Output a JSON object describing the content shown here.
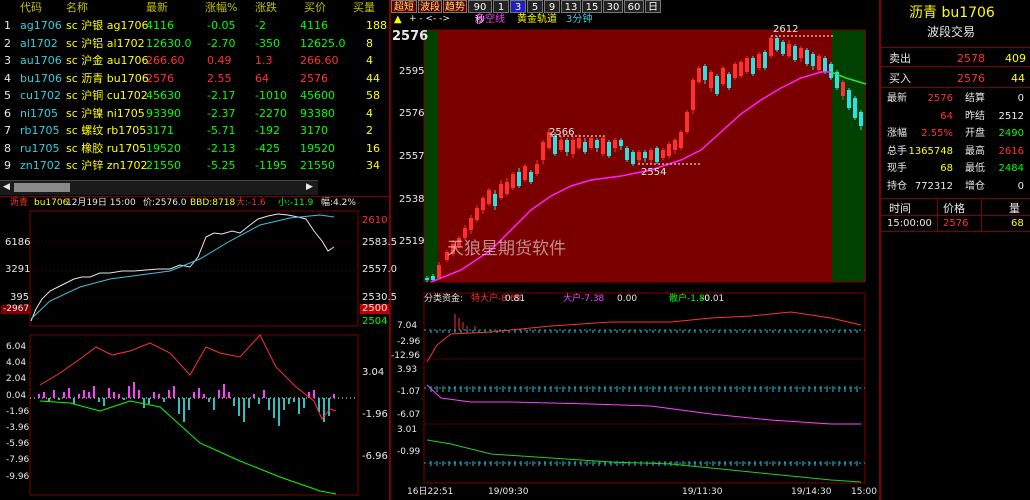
{
  "table": {
    "headers": [
      "代码",
      "名称",
      "最新",
      "涨幅%",
      "涨跌",
      "买价",
      "买量"
    ],
    "rows": [
      {
        "idx": "1",
        "code": "ag1706",
        "name": "sc 沪银 ag1706",
        "last": "4116",
        "pct": "-0.05",
        "chg": "-2",
        "bid": "4116",
        "vol": "188",
        "dir": "down"
      },
      {
        "idx": "2",
        "code": "al1702",
        "name": "sc 沪铝 al1702",
        "last": "12630.0",
        "pct": "-2.70",
        "chg": "-350",
        "bid": "12625.0",
        "vol": "8",
        "dir": "down"
      },
      {
        "idx": "3",
        "code": "au1706",
        "name": "sc 沪金 au1706",
        "last": "266.60",
        "pct": "0.49",
        "chg": "1.3",
        "bid": "266.60",
        "vol": "4",
        "dir": "up"
      },
      {
        "idx": "4",
        "code": "bu1706",
        "name": "sc 沥青 bu1706",
        "last": "2576",
        "pct": "2.55",
        "chg": "64",
        "bid": "2576",
        "vol": "44",
        "dir": "up"
      },
      {
        "idx": "5",
        "code": "cu1702",
        "name": "sc 沪铜 cu1702",
        "last": "45630",
        "pct": "-2.17",
        "chg": "-1010",
        "bid": "45600",
        "vol": "58",
        "dir": "down"
      },
      {
        "idx": "6",
        "code": "ni1705",
        "name": "sc 沪镍 ni1705",
        "last": "93390",
        "pct": "-2.37",
        "chg": "-2270",
        "bid": "93380",
        "vol": "4",
        "dir": "down"
      },
      {
        "idx": "7",
        "code": "rb1705",
        "name": "sc 螺纹 rb1705",
        "last": "3171",
        "pct": "-5.71",
        "chg": "-192",
        "bid": "3170",
        "vol": "2",
        "dir": "down"
      },
      {
        "idx": "8",
        "code": "ru1705",
        "name": "sc 橡胶 ru1705",
        "last": "19520",
        "pct": "-2.13",
        "chg": "-425",
        "bid": "19520",
        "vol": "16",
        "dir": "down"
      },
      {
        "idx": "9",
        "code": "zn1702",
        "name": "sc 沪锌 zn1702",
        "last": "21550",
        "pct": "-5.25",
        "chg": "-1195",
        "bid": "21550",
        "vol": "34",
        "dir": "down"
      }
    ]
  },
  "intraday": {
    "title_name": "沥青",
    "title_code": "bu1706",
    "date": "12月19日 15:00",
    "price_label": "价:2576.0",
    "bbd": "BBD:8718",
    "big": "大:-1.6",
    "small": "小:-11.9",
    "amp": "幅:4.2%",
    "left_scale": [
      "6186",
      "3291",
      "395",
      "-2967"
    ],
    "right_scale": [
      "2610",
      "2583.5",
      "2557.0",
      "2530.5",
      "2500",
      "2504"
    ],
    "lower_left_scale": [
      "6.04",
      "4.04",
      "2.04",
      "0.04",
      "-1.96",
      "-3.96",
      "-5.96",
      "-7.96",
      "-9.96"
    ],
    "lower_right_scale": [
      "3.04",
      "-1.96",
      "-6.96"
    ]
  },
  "kline": {
    "toolbar": [
      "超短",
      "波段",
      "趋势",
      "90秒",
      "1",
      "3",
      "5",
      "9",
      "13",
      "15",
      "30",
      "60",
      "日"
    ],
    "toolbar_active": "3",
    "legend_prefix": "+  -  <-  ->",
    "legend": [
      "多空线",
      "黄金轨道",
      "3分钟"
    ],
    "price_scale": [
      "2576",
      "2595",
      "2576",
      "2557",
      "2538",
      "2519"
    ],
    "annotations": {
      "high": "2612",
      "mid": "2566",
      "low": "2554"
    },
    "watermark": "天狼星期货软件",
    "flow_label": "分类资金:",
    "flow_items": [
      {
        "t": "特大户-8.69",
        "c": "red"
      },
      {
        "t": "0.81",
        "c": "white"
      },
      {
        "t": "大户-7.38",
        "c": "mag"
      },
      {
        "t": "0.00",
        "c": "white"
      },
      {
        "t": "散户-1.80",
        "c": "green"
      },
      {
        "t": "-0.01",
        "c": "white"
      }
    ],
    "flow_scale": [
      "7.04",
      "-2.96",
      "-12.96",
      "3.93",
      "-1.07",
      "-6.07",
      "3.01",
      "-0.99"
    ],
    "time_axis": [
      "16日22:51",
      "19/09:30",
      "19/11:30",
      "19/14:30",
      "15:00"
    ]
  },
  "quote": {
    "title": "沥青 bu1706",
    "subtitle": "波段交易",
    "sell": {
      "label": "卖出",
      "price": "2578",
      "vol": "409"
    },
    "buy": {
      "label": "买入",
      "price": "2576",
      "vol": "44"
    },
    "rows": [
      {
        "l1": "最新",
        "v1": "2576",
        "c1": "red",
        "l2": "结算",
        "v2": "0",
        "c2": "white"
      },
      {
        "l1": "",
        "v1": "64",
        "c1": "red",
        "l2": "昨结",
        "v2": "2512",
        "c2": "white"
      },
      {
        "l1": "涨幅",
        "v1": "2.55%",
        "c1": "red",
        "l2": "开盘",
        "v2": "2490",
        "c2": "green"
      },
      {
        "l1": "总手",
        "v1": "1365748",
        "c1": "yellow",
        "l2": "最高",
        "v2": "2616",
        "c2": "red"
      },
      {
        "l1": "现手",
        "v1": "68",
        "c1": "yellow",
        "l2": "最低",
        "v2": "2484",
        "c2": "green"
      },
      {
        "l1": "持仓",
        "v1": "772312",
        "c1": "white",
        "l2": "增仓",
        "v2": "0",
        "c2": "white"
      }
    ],
    "tick_headers": [
      "时间",
      "价格",
      "量"
    ],
    "tick": {
      "time": "15:00:00",
      "price": "2576",
      "vol": "68"
    }
  },
  "colors": {
    "up": "#ff3030",
    "down": "#00ff00",
    "bg": "#000000",
    "grid": "#800000",
    "toolbar_active": "#2020c0"
  }
}
